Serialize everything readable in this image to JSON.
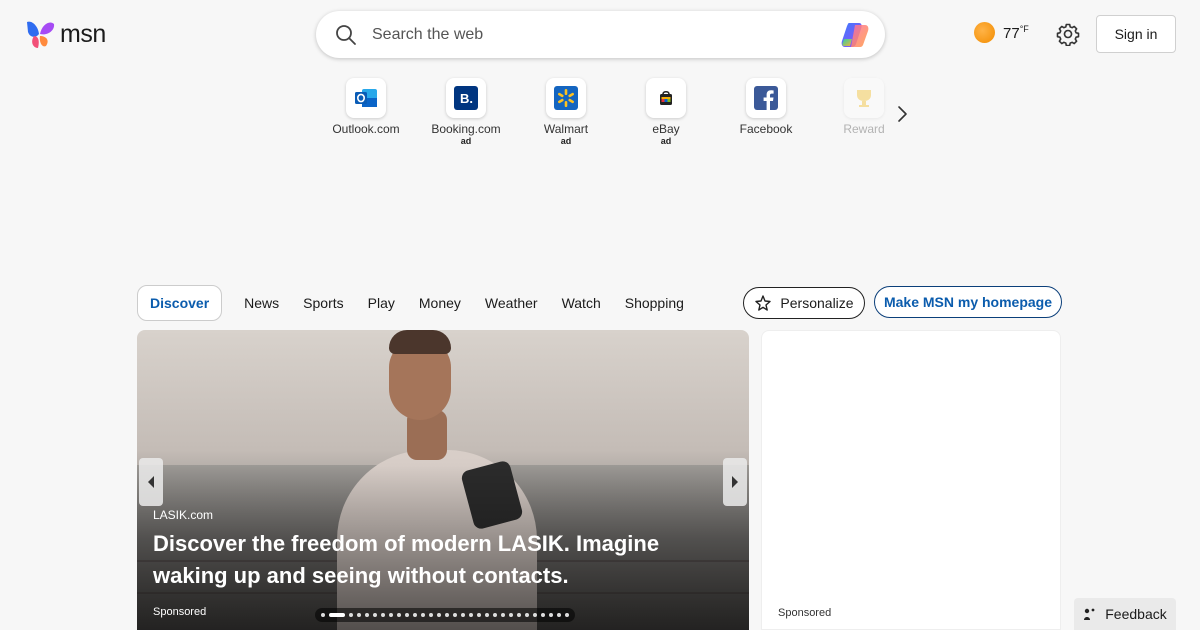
{
  "header": {
    "logo_text": "msn",
    "search_placeholder": "Search the web",
    "weather": {
      "temp": "77",
      "unit": "°F"
    },
    "signin_label": "Sign in"
  },
  "quicklinks": [
    {
      "label": "Outlook.com",
      "ad": "",
      "icon": "outlook-icon",
      "color": "#0a64c8"
    },
    {
      "label": "Booking.com",
      "ad": "ad",
      "icon": "booking-icon",
      "color": "#003580"
    },
    {
      "label": "Walmart",
      "ad": "ad",
      "icon": "walmart-icon",
      "color": "#1565c0"
    },
    {
      "label": "eBay",
      "ad": "ad",
      "icon": "ebay-icon",
      "color": "#222222"
    },
    {
      "label": "Facebook",
      "ad": "",
      "icon": "facebook-icon",
      "color": "#3b5998"
    },
    {
      "label": "Reward",
      "ad": "",
      "icon": "reward-icon",
      "color": "#f2b400"
    }
  ],
  "tabs": [
    "Discover",
    "News",
    "Sports",
    "Play",
    "Money",
    "Weather",
    "Watch",
    "Shopping"
  ],
  "actions": {
    "personalize_label": "Personalize",
    "homepage_label": "Make MSN my homepage"
  },
  "hero": {
    "source": "LASIK.com",
    "title": "Discover the freedom of modern LASIK. Imagine waking up and seeing without contacts.",
    "sponsored": "Sponsored",
    "slide_count": 30,
    "active_slide": 1
  },
  "adcard": {
    "sponsored": "Sponsored"
  },
  "feedback_label": "Feedback",
  "colors": {
    "accent": "#0b5cad",
    "background": "#f7f7f7"
  }
}
